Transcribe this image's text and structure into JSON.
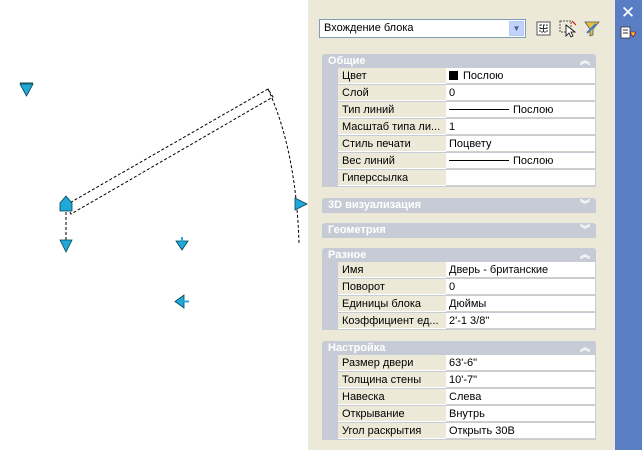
{
  "palette": {
    "selector_value": "Вхождение блока",
    "sections": [
      {
        "title": "Общие",
        "expanded": true,
        "rows": [
          {
            "label": "Цвет",
            "value": "Послою",
            "swatch": "#000000"
          },
          {
            "label": "Слой",
            "value": "0"
          },
          {
            "label": "Тип линий",
            "value": "Послою",
            "line": true
          },
          {
            "label": "Масштаб типа ли...",
            "value": "1"
          },
          {
            "label": "Стиль печати",
            "value": "Поцвету"
          },
          {
            "label": "Вес линий",
            "value": "Послою",
            "line": true
          },
          {
            "label": "Гиперссылка",
            "value": ""
          }
        ]
      },
      {
        "title": "3D визуализация",
        "expanded": false,
        "rows": []
      },
      {
        "title": "Геометрия",
        "expanded": false,
        "rows": []
      },
      {
        "title": "Разное",
        "expanded": true,
        "rows": [
          {
            "label": "Имя",
            "value": "Дверь - британские"
          },
          {
            "label": "Поворот",
            "value": "0"
          },
          {
            "label": "Единицы блока",
            "value": "Дюймы"
          },
          {
            "label": "Коэффициент ед...",
            "value": "2'-1 3/8\""
          }
        ]
      },
      {
        "title": "Настройка",
        "expanded": true,
        "rows": [
          {
            "label": "Размер двери",
            "value": "63'-6\""
          },
          {
            "label": "Толщина стены",
            "value": "10'-7\""
          },
          {
            "label": "Навеска",
            "value": "Слева"
          },
          {
            "label": "Открывание",
            "value": "Внутрь"
          },
          {
            "label": "Угол раскрытия",
            "value": "Открыть 30Β"
          }
        ]
      }
    ]
  },
  "icons": {
    "close": "close-icon",
    "select_objects": "select-objects-icon",
    "pickadd": "pickadd-toggle-icon",
    "quick_select": "quick-select-icon",
    "properties_menu": "properties-menu-icon"
  },
  "colors": {
    "grip": "#1fa8d8",
    "titlebar": "#5a7ec4",
    "section": "#c7cbd5"
  }
}
